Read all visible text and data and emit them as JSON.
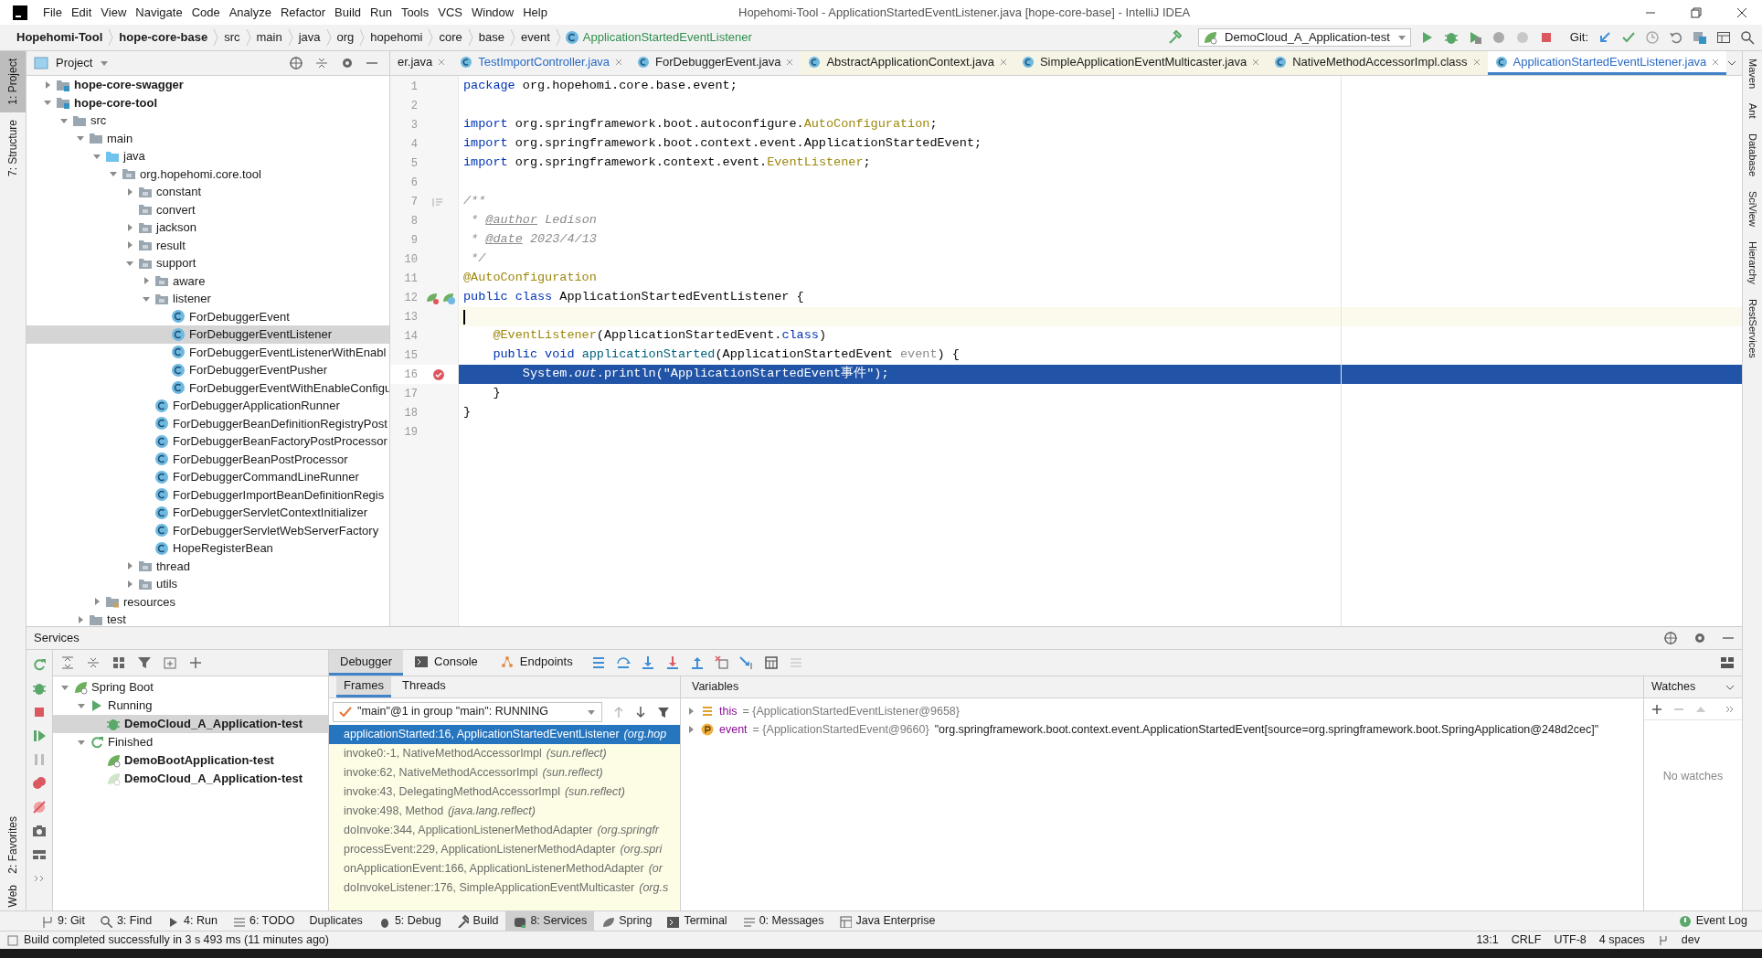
{
  "menu": [
    "File",
    "Edit",
    "View",
    "Navigate",
    "Code",
    "Analyze",
    "Refactor",
    "Build",
    "Run",
    "Tools",
    "VCS",
    "Window",
    "Help"
  ],
  "window_title": "Hopehomi-Tool - ApplicationStartedEventListener.java [hope-core-base] - IntelliJ IDEA",
  "breadcrumbs": [
    "Hopehomi-Tool",
    "hope-core-base",
    "src",
    "main",
    "java",
    "org",
    "hopehomi",
    "core",
    "base",
    "event",
    "ApplicationStartedEventListener"
  ],
  "run_config": "DemoCloud_A_Application-test",
  "git_label": "Git:",
  "left_stripe": [
    {
      "label": "1: Project",
      "selected": true
    },
    {
      "label": "7: Structure",
      "selected": false
    }
  ],
  "left_stripe_bottom": [
    {
      "label": "2: Favorites"
    },
    {
      "label": "Web"
    }
  ],
  "right_stripe": [
    "Maven",
    "Ant",
    "Database",
    "SciView",
    "Hierarchy",
    "RestServices"
  ],
  "project": {
    "title": "Project",
    "tree": [
      {
        "label": "hope-core-swagger",
        "kind": "module",
        "expanded": false,
        "selected": false
      },
      {
        "label": "hope-core-tool",
        "kind": "module",
        "expanded": true,
        "selected": false,
        "children": [
          {
            "label": "src",
            "kind": "folder",
            "expanded": true,
            "selected": false,
            "children": [
              {
                "label": "main",
                "kind": "folder",
                "expanded": true,
                "selected": false,
                "children": [
                  {
                    "label": "java",
                    "kind": "source",
                    "expanded": true,
                    "selected": false,
                    "children": [
                      {
                        "label": "org.hopehomi.core.tool",
                        "kind": "package",
                        "expanded": true,
                        "selected": false,
                        "children": [
                          {
                            "label": "constant",
                            "kind": "package",
                            "expanded": false,
                            "selected": false
                          },
                          {
                            "label": "convert",
                            "kind": "package",
                            "selected": false
                          },
                          {
                            "label": "jackson",
                            "kind": "package",
                            "expanded": false,
                            "selected": false
                          },
                          {
                            "label": "result",
                            "kind": "package",
                            "expanded": false,
                            "selected": false
                          },
                          {
                            "label": "support",
                            "kind": "package",
                            "expanded": true,
                            "selected": false,
                            "children": [
                              {
                                "label": "aware",
                                "kind": "package",
                                "expanded": false,
                                "selected": false
                              },
                              {
                                "label": "listener",
                                "kind": "package",
                                "expanded": true,
                                "selected": false,
                                "children": [
                                  {
                                    "label": "ForDebuggerEvent",
                                    "kind": "class",
                                    "selected": false
                                  },
                                  {
                                    "label": "ForDebuggerEventListener",
                                    "kind": "class",
                                    "selected": true
                                  },
                                  {
                                    "label": "ForDebuggerEventListenerWithEnabl",
                                    "kind": "class",
                                    "selected": false
                                  },
                                  {
                                    "label": "ForDebuggerEventPusher",
                                    "kind": "class",
                                    "selected": false
                                  },
                                  {
                                    "label": "ForDebuggerEventWithEnableConfigu",
                                    "kind": "class",
                                    "selected": false
                                  }
                                ]
                              },
                              {
                                "label": "ForDebuggerApplicationRunner",
                                "kind": "class",
                                "selected": false
                              },
                              {
                                "label": "ForDebuggerBeanDefinitionRegistryPost",
                                "kind": "class",
                                "selected": false
                              },
                              {
                                "label": "ForDebuggerBeanFactoryPostProcessor",
                                "kind": "class",
                                "selected": false
                              },
                              {
                                "label": "ForDebuggerBeanPostProcessor",
                                "kind": "class",
                                "selected": false
                              },
                              {
                                "label": "ForDebuggerCommandLineRunner",
                                "kind": "class",
                                "selected": false
                              },
                              {
                                "label": "ForDebuggerImportBeanDefinitionRegis",
                                "kind": "class",
                                "selected": false
                              },
                              {
                                "label": "ForDebuggerServletContextInitializer",
                                "kind": "class",
                                "selected": false
                              },
                              {
                                "label": "ForDebuggerServletWebServerFactory",
                                "kind": "class",
                                "selected": false
                              },
                              {
                                "label": "HopeRegisterBean",
                                "kind": "class",
                                "selected": false
                              }
                            ]
                          },
                          {
                            "label": "thread",
                            "kind": "package",
                            "expanded": false,
                            "selected": false
                          },
                          {
                            "label": "utils",
                            "kind": "package",
                            "expanded": false,
                            "selected": false
                          }
                        ]
                      }
                    ]
                  },
                  {
                    "label": "resources",
                    "kind": "resources",
                    "expanded": false,
                    "selected": false
                  }
                ]
              },
              {
                "label": "test",
                "kind": "folder",
                "expanded": false,
                "selected": false
              }
            ]
          }
        ]
      }
    ]
  },
  "editor_tabs": [
    {
      "label": "er.java",
      "kind": "cut",
      "modified": false,
      "selected": false
    },
    {
      "label": "TestImportController.java",
      "kind": "source",
      "modified": true,
      "selected": false
    },
    {
      "label": "ForDebuggerEvent.java",
      "kind": "source",
      "modified": false,
      "selected": false
    },
    {
      "label": "AbstractApplicationContext.java",
      "kind": "library",
      "modified": false,
      "selected": false
    },
    {
      "label": "SimpleApplicationEventMulticaster.java",
      "kind": "library",
      "modified": false,
      "selected": false
    },
    {
      "label": "NativeMethodAccessorImpl.class",
      "kind": "library",
      "modified": false,
      "selected": false
    },
    {
      "label": "ApplicationStartedEventListener.java",
      "kind": "source",
      "modified": true,
      "selected": true
    }
  ],
  "code": [
    {
      "number": "1",
      "kind": "plain",
      "tokens": [
        {
          "kind": "kw",
          "text": "package "
        },
        {
          "kind": "plain",
          "text": "org.hopehomi.core.base.event;"
        }
      ]
    },
    {
      "number": "2",
      "kind": "plain"
    },
    {
      "number": "3",
      "kind": "plain",
      "tokens": [
        {
          "kind": "kw",
          "text": "import "
        },
        {
          "kind": "plain",
          "text": "org.springframework.boot.autoconfigure."
        },
        {
          "kind": "ann",
          "text": "AutoConfiguration"
        },
        {
          "kind": "plain",
          "text": ";"
        }
      ]
    },
    {
      "number": "4",
      "kind": "plain",
      "tokens": [
        {
          "kind": "kw",
          "text": "import "
        },
        {
          "kind": "plain",
          "text": "org.springframework.boot.context.event.ApplicationStartedEvent;"
        }
      ]
    },
    {
      "number": "5",
      "kind": "plain",
      "tokens": [
        {
          "kind": "kw",
          "text": "import "
        },
        {
          "kind": "plain",
          "text": "org.springframework.context.event."
        },
        {
          "kind": "ann",
          "text": "EventListener"
        },
        {
          "kind": "plain",
          "text": ";"
        }
      ]
    },
    {
      "number": "6",
      "kind": "plain"
    },
    {
      "number": "7",
      "kind": "doc",
      "tokens": [
        {
          "kind": "comment",
          "text": "/**"
        }
      ]
    },
    {
      "number": "8",
      "kind": "plain",
      "tokens": [
        {
          "kind": "comment",
          "text": " * "
        },
        {
          "kind": "doctag",
          "text": "@author"
        },
        {
          "kind": "comment",
          "text": " Ledison"
        }
      ]
    },
    {
      "number": "9",
      "kind": "plain",
      "tokens": [
        {
          "kind": "comment",
          "text": " * "
        },
        {
          "kind": "doctag",
          "text": "@date"
        },
        {
          "kind": "comment",
          "text": " 2023/4/13"
        }
      ]
    },
    {
      "number": "10",
      "kind": "plain",
      "tokens": [
        {
          "kind": "comment",
          "text": " */"
        }
      ]
    },
    {
      "number": "11",
      "kind": "plain",
      "tokens": [
        {
          "kind": "ann",
          "text": "@AutoConfiguration"
        }
      ]
    },
    {
      "number": "12",
      "kind": "spring",
      "tokens": [
        {
          "kind": "kw",
          "text": "public class "
        },
        {
          "kind": "plain",
          "text": "ApplicationStartedEventListener {"
        }
      ]
    },
    {
      "number": "13",
      "kind": "caret"
    },
    {
      "number": "14",
      "kind": "plain",
      "tokens": [
        {
          "kind": "ann",
          "text": "    @EventListener"
        },
        {
          "kind": "plain",
          "text": "(ApplicationStartedEvent."
        },
        {
          "kind": "kw",
          "text": "class"
        },
        {
          "kind": "plain",
          "text": ")"
        }
      ]
    },
    {
      "number": "15",
      "kind": "plain",
      "tokens": [
        {
          "kind": "kw",
          "text": "    public void "
        },
        {
          "kind": "method",
          "text": "applicationStarted"
        },
        {
          "kind": "plain",
          "text": "(ApplicationStartedEvent "
        },
        {
          "kind": "param",
          "text": "event"
        },
        {
          "kind": "plain",
          "text": ") {"
        }
      ]
    },
    {
      "number": "16",
      "kind": "execution",
      "tokens": [
        {
          "kind": "plain",
          "text": "        System."
        },
        {
          "kind": "static",
          "text": "out"
        },
        {
          "kind": "plain",
          "text": ".println("
        },
        {
          "kind": "str",
          "text": "\"ApplicationStartedEvent事件\""
        },
        {
          "kind": "plain",
          "text": ");"
        }
      ]
    },
    {
      "number": "17",
      "kind": "plain",
      "tokens": [
        {
          "kind": "plain",
          "text": "    }"
        }
      ]
    },
    {
      "number": "18",
      "kind": "plain",
      "tokens": [
        {
          "kind": "plain",
          "text": "}"
        }
      ]
    },
    {
      "number": "19",
      "kind": "plain"
    }
  ],
  "services": {
    "title": "Services",
    "tree": [
      {
        "label": "Spring Boot",
        "kind": "spring",
        "expanded": true,
        "selected": false,
        "children": [
          {
            "label": "Running",
            "kind": "running",
            "expanded": true,
            "selected": false,
            "children": [
              {
                "label": "DemoCloud_A_Application-test",
                "kind": "debug",
                "selected": true
              }
            ]
          },
          {
            "label": "Finished",
            "kind": "finished",
            "expanded": true,
            "selected": false,
            "children": [
              {
                "label": "DemoBootApplication-test",
                "kind": "app",
                "selected": false
              },
              {
                "label": "DemoCloud_A_Application-test",
                "kind": "app_faded",
                "selected": false
              }
            ]
          }
        ]
      }
    ]
  },
  "debug_tabs": [
    {
      "label": "Debugger",
      "kind": "debugger",
      "selected": true
    },
    {
      "label": "Console",
      "kind": "console",
      "selected": false
    },
    {
      "label": "Endpoints",
      "kind": "endpoints",
      "selected": false
    }
  ],
  "frame_tabs": [
    {
      "label": "Frames",
      "selected": true
    },
    {
      "label": "Threads",
      "selected": false
    }
  ],
  "thread": "\"main\"@1 in group \"main\": RUNNING",
  "frames": [
    {
      "method": "applicationStarted:16, ApplicationStartedEventListener",
      "package": "(org.hop",
      "selected": true
    },
    {
      "method": "invoke0:-1, NativeMethodAccessorImpl",
      "package": "(sun.reflect)",
      "selected": false
    },
    {
      "method": "invoke:62, NativeMethodAccessorImpl",
      "package": "(sun.reflect)",
      "selected": false
    },
    {
      "method": "invoke:43, DelegatingMethodAccessorImpl",
      "package": "(sun.reflect)",
      "selected": false
    },
    {
      "method": "invoke:498, Method",
      "package": "(java.lang.reflect)",
      "selected": false
    },
    {
      "method": "doInvoke:344, ApplicationListenerMethodAdapter",
      "package": "(org.springfr",
      "selected": false
    },
    {
      "method": "processEvent:229, ApplicationListenerMethodAdapter",
      "package": "(org.spri",
      "selected": false
    },
    {
      "method": "onApplicationEvent:166, ApplicationListenerMethodAdapter",
      "package": "(or",
      "selected": false
    },
    {
      "method": "doInvokeListener:176, SimpleApplicationEventMulticaster",
      "package": "(org.s",
      "selected": false
    }
  ],
  "variables_title": "Variables",
  "variables": [
    {
      "kind": "field",
      "name": "this",
      "value": "= {ApplicationStartedEventListener@9658}"
    },
    {
      "kind": "param",
      "name": "event",
      "value": "= {ApplicationStartedEvent@9660}",
      "string": "\"org.springframework.boot.context.event.ApplicationStartedEvent[source=org.springframework.boot.SpringApplication@248d2cec]\""
    }
  ],
  "watches_title": "Watches",
  "watches_empty": "No watches",
  "tool_windows": [
    {
      "label": "9: Git",
      "selected": false
    },
    {
      "label": "3: Find",
      "selected": false
    },
    {
      "label": "4: Run",
      "selected": false
    },
    {
      "label": "6: TODO",
      "selected": false
    },
    {
      "label": "Duplicates",
      "selected": false
    },
    {
      "label": "5: Debug",
      "selected": false
    },
    {
      "label": "Build",
      "selected": false
    },
    {
      "label": "8: Services",
      "selected": true
    },
    {
      "label": "Spring",
      "selected": false
    },
    {
      "label": "Terminal",
      "selected": false
    },
    {
      "label": "0: Messages",
      "selected": false
    },
    {
      "label": "Java Enterprise",
      "selected": false
    }
  ],
  "event_log": "Event Log",
  "status": "Build completed successfully in 3 s 493 ms (11 minutes ago)",
  "status_right": [
    "13:1",
    "CRLF",
    "UTF-8",
    "4 spaces",
    "dev"
  ]
}
